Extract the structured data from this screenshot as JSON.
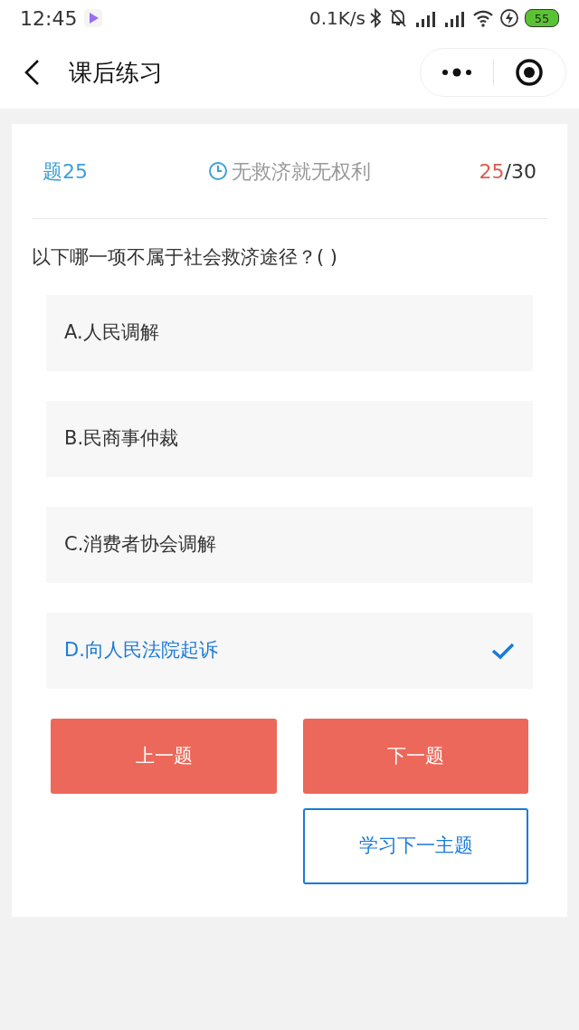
{
  "status_bar": {
    "time": "12:45",
    "network_speed": "0.1K/s",
    "battery": "55"
  },
  "nav": {
    "title": "课后练习"
  },
  "quiz": {
    "number": "题25",
    "topic": "无救济就无权利",
    "progress_current": "25",
    "progress_total": "/30",
    "question": "以下哪一项不属于社会救济途径？( )",
    "options": [
      {
        "label": "A.人民调解",
        "selected": false
      },
      {
        "label": "B.民商事仲裁",
        "selected": false
      },
      {
        "label": "C.消费者协会调解",
        "selected": false
      },
      {
        "label": "D.向人民法院起诉",
        "selected": true
      }
    ],
    "prev_button": "上一题",
    "next_button": "下一题",
    "next_topic_button": "学习下一主题"
  }
}
